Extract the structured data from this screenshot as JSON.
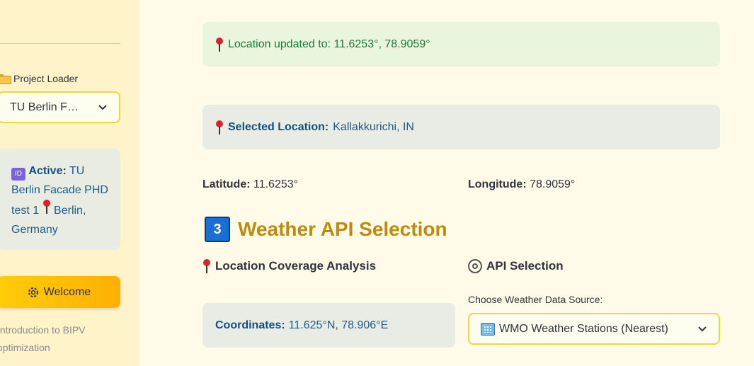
{
  "sidebar": {
    "project_loader_label": "Project Loader",
    "project_select_value": "TU Berlin F…",
    "active_prefix": "Active:",
    "active_text": "TU Berlin Facade PHD test 1",
    "active_location": "Berlin, Germany",
    "id_badge_text": "ID",
    "welcome_label": "Welcome",
    "welcome_desc": "Introduction to BIPV optimization"
  },
  "main": {
    "success_alert": "Location updated to: 11.6253°, 78.9059°",
    "selected_location_label": "Selected Location:",
    "selected_location_value": "Kallakkurichi, IN",
    "latitude_label": "Latitude:",
    "latitude_value": "11.6253°",
    "longitude_label": "Longitude:",
    "longitude_value": "78.9059°",
    "section_number": "3",
    "section_title": "Weather API Selection",
    "coverage_heading": "Location Coverage Analysis",
    "api_heading": "API Selection",
    "coordinates_label": "Coordinates:",
    "coordinates_value": "11.625°N, 78.906°E",
    "api_field_label": "Choose Weather Data Source:",
    "api_select_value": "WMO Weather Stations (Nearest)"
  },
  "colors": {
    "accent_yellow": "#ffc107",
    "section_title": "#c08a0c",
    "info_text": "#1f5a8c",
    "success_text": "#1d7a3a"
  }
}
